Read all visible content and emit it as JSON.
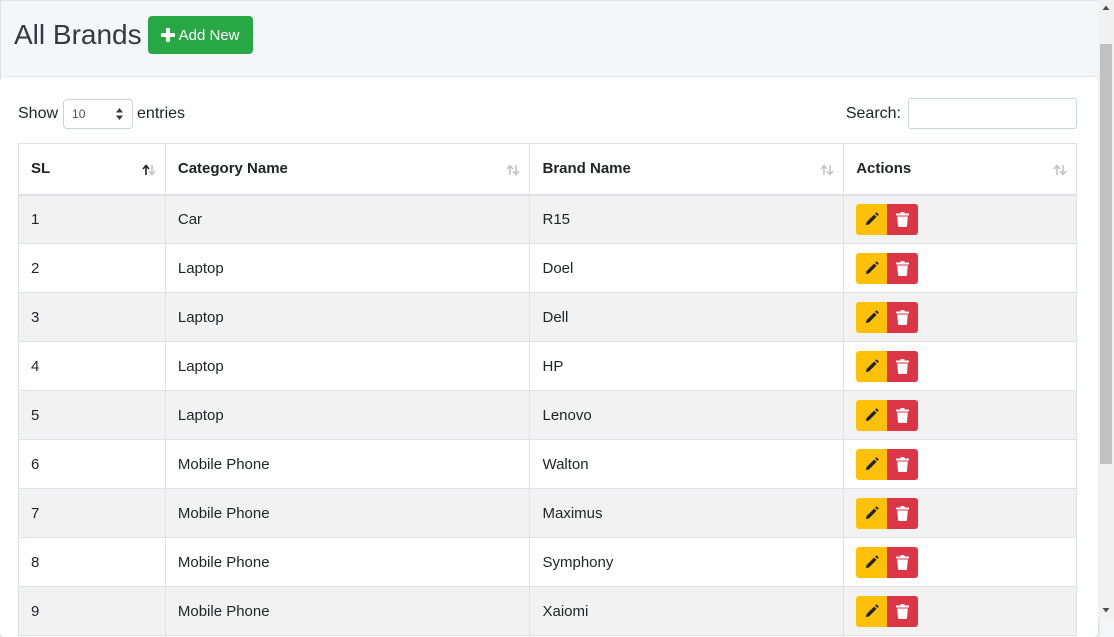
{
  "header": {
    "title": "All Brands",
    "add_button_label": "Add New"
  },
  "controls": {
    "show_label": "Show",
    "entries_value": "10",
    "entries_label": "entries",
    "search_label": "Search:",
    "search_value": ""
  },
  "table": {
    "columns": [
      "SL",
      "Category Name",
      "Brand Name",
      "Actions"
    ],
    "rows": [
      {
        "sl": "1",
        "category": "Car",
        "brand": "R15"
      },
      {
        "sl": "2",
        "category": "Laptop",
        "brand": "Doel"
      },
      {
        "sl": "3",
        "category": "Laptop",
        "brand": "Dell"
      },
      {
        "sl": "4",
        "category": "Laptop",
        "brand": "HP"
      },
      {
        "sl": "5",
        "category": "Laptop",
        "brand": "Lenovo"
      },
      {
        "sl": "6",
        "category": "Mobile Phone",
        "brand": "Walton"
      },
      {
        "sl": "7",
        "category": "Mobile Phone",
        "brand": "Maximus"
      },
      {
        "sl": "8",
        "category": "Mobile Phone",
        "brand": "Symphony"
      },
      {
        "sl": "9",
        "category": "Mobile Phone",
        "brand": "Xaiomi"
      }
    ]
  },
  "colors": {
    "add_button": "#28a745",
    "edit_button": "#ffc107",
    "delete_button": "#dc3545",
    "striped_row": "#f2f2f2"
  },
  "icons": {
    "add": "plus-icon",
    "edit": "pencil-icon",
    "delete": "trash-icon",
    "sort": "sort-icon"
  }
}
